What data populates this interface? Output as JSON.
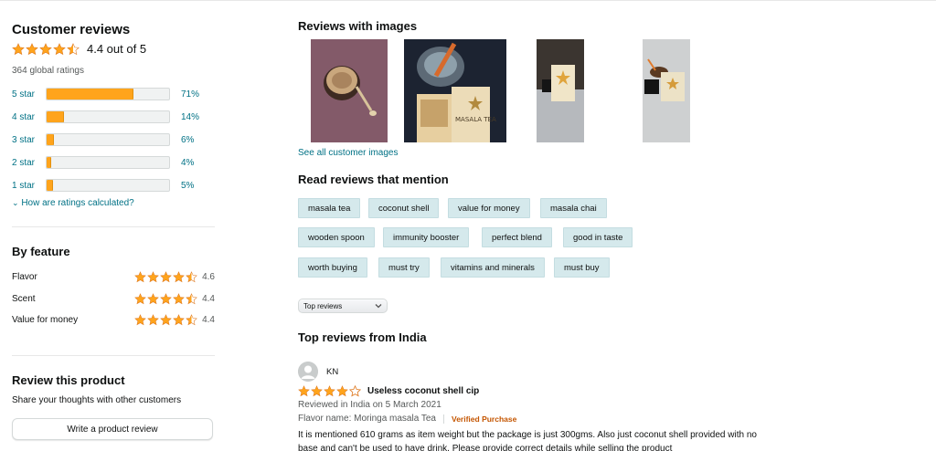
{
  "customer_reviews": {
    "title": "Customer reviews",
    "rating_text": "4.4 out of 5",
    "global_ratings": "364 global ratings",
    "histogram": [
      {
        "label": "5 star",
        "percent_text": "71%",
        "percent": 71
      },
      {
        "label": "4 star",
        "percent_text": "14%",
        "percent": 14
      },
      {
        "label": "3 star",
        "percent_text": "6%",
        "percent": 6
      },
      {
        "label": "2 star",
        "percent_text": "4%",
        "percent": 4
      },
      {
        "label": "1 star",
        "percent_text": "5%",
        "percent": 5
      }
    ],
    "how_calculated": "How are ratings calculated?"
  },
  "by_feature": {
    "title": "By feature",
    "features": [
      {
        "name": "Flavor",
        "value": "4.6"
      },
      {
        "name": "Scent",
        "value": "4.4"
      },
      {
        "name": "Value for money",
        "value": "4.4"
      }
    ]
  },
  "review_product": {
    "title": "Review this product",
    "subtitle": "Share your thoughts with other customers",
    "button": "Write a product review"
  },
  "reviews_with_images": {
    "title": "Reviews with images",
    "see_all": "See all customer images"
  },
  "read_reviews_mention": {
    "title": "Read reviews that mention",
    "chips": [
      "masala tea",
      "coconut shell",
      "value for money",
      "masala chai",
      "wooden spoon",
      "immunity booster",
      "perfect blend",
      "good in taste",
      "worth buying",
      "must try",
      "vitamins and minerals",
      "must buy"
    ]
  },
  "sort": {
    "selected": "Top reviews"
  },
  "top_reviews": {
    "title": "Top reviews from India",
    "review": {
      "author": "KN",
      "rating": 4,
      "headline": "Useless coconut shell cip",
      "date": "Reviewed in India on 5 March 2021",
      "flavor": "Flavor name: Moringa masala Tea",
      "verified": "Verified Purchase",
      "body": "It is mentioned 610 grams as item weight but the package is just 300gms. Also just coconut shell provided with no base and can't be used to have drink. Please provide correct details while selling the product"
    }
  },
  "colors": {
    "star": "#ffa41c",
    "link": "#007185",
    "chip_bg": "#d5e9ec",
    "verified": "#c45500"
  }
}
